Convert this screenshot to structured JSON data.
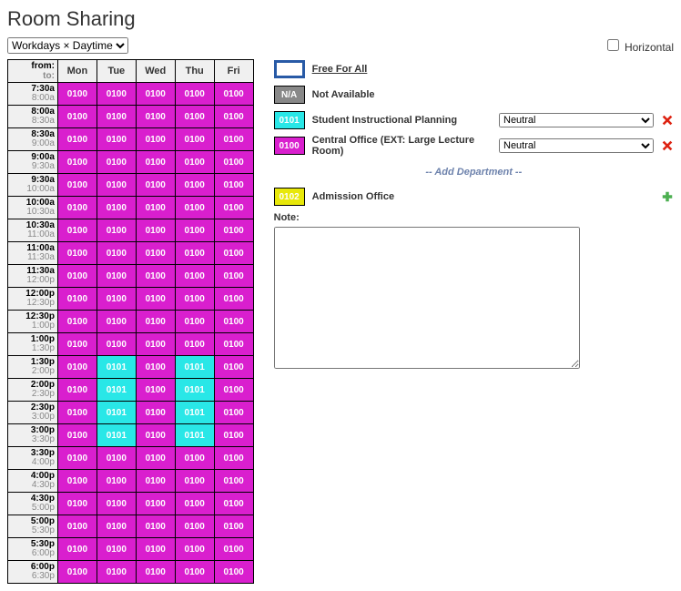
{
  "title": "Room Sharing",
  "mode_select": "Workdays × Daytime",
  "horizontal_label": "Horizontal",
  "horizontal_checked": false,
  "corner_from": "from:",
  "corner_to": "to:",
  "days": [
    "Mon",
    "Tue",
    "Wed",
    "Thu",
    "Fri"
  ],
  "times": [
    {
      "from": "7:30a",
      "to": "8:00a"
    },
    {
      "from": "8:00a",
      "to": "8:30a"
    },
    {
      "from": "8:30a",
      "to": "9:00a"
    },
    {
      "from": "9:00a",
      "to": "9:30a"
    },
    {
      "from": "9:30a",
      "to": "10:00a"
    },
    {
      "from": "10:00a",
      "to": "10:30a"
    },
    {
      "from": "10:30a",
      "to": "11:00a"
    },
    {
      "from": "11:00a",
      "to": "11:30a"
    },
    {
      "from": "11:30a",
      "to": "12:00p"
    },
    {
      "from": "12:00p",
      "to": "12:30p"
    },
    {
      "from": "12:30p",
      "to": "1:00p"
    },
    {
      "from": "1:00p",
      "to": "1:30p"
    },
    {
      "from": "1:30p",
      "to": "2:00p"
    },
    {
      "from": "2:00p",
      "to": "2:30p"
    },
    {
      "from": "2:30p",
      "to": "3:00p"
    },
    {
      "from": "3:00p",
      "to": "3:30p"
    },
    {
      "from": "3:30p",
      "to": "4:00p"
    },
    {
      "from": "4:00p",
      "to": "4:30p"
    },
    {
      "from": "4:30p",
      "to": "5:00p"
    },
    {
      "from": "5:00p",
      "to": "5:30p"
    },
    {
      "from": "5:30p",
      "to": "6:00p"
    },
    {
      "from": "6:00p",
      "to": "6:30p"
    }
  ],
  "grid": [
    [
      "0100",
      "0100",
      "0100",
      "0100",
      "0100"
    ],
    [
      "0100",
      "0100",
      "0100",
      "0100",
      "0100"
    ],
    [
      "0100",
      "0100",
      "0100",
      "0100",
      "0100"
    ],
    [
      "0100",
      "0100",
      "0100",
      "0100",
      "0100"
    ],
    [
      "0100",
      "0100",
      "0100",
      "0100",
      "0100"
    ],
    [
      "0100",
      "0100",
      "0100",
      "0100",
      "0100"
    ],
    [
      "0100",
      "0100",
      "0100",
      "0100",
      "0100"
    ],
    [
      "0100",
      "0100",
      "0100",
      "0100",
      "0100"
    ],
    [
      "0100",
      "0100",
      "0100",
      "0100",
      "0100"
    ],
    [
      "0100",
      "0100",
      "0100",
      "0100",
      "0100"
    ],
    [
      "0100",
      "0100",
      "0100",
      "0100",
      "0100"
    ],
    [
      "0100",
      "0100",
      "0100",
      "0100",
      "0100"
    ],
    [
      "0100",
      "0101",
      "0100",
      "0101",
      "0100"
    ],
    [
      "0100",
      "0101",
      "0100",
      "0101",
      "0100"
    ],
    [
      "0100",
      "0101",
      "0100",
      "0101",
      "0100"
    ],
    [
      "0100",
      "0101",
      "0100",
      "0101",
      "0100"
    ],
    [
      "0100",
      "0100",
      "0100",
      "0100",
      "0100"
    ],
    [
      "0100",
      "0100",
      "0100",
      "0100",
      "0100"
    ],
    [
      "0100",
      "0100",
      "0100",
      "0100",
      "0100"
    ],
    [
      "0100",
      "0100",
      "0100",
      "0100",
      "0100"
    ],
    [
      "0100",
      "0100",
      "0100",
      "0100",
      "0100"
    ],
    [
      "0100",
      "0100",
      "0100",
      "0100",
      "0100"
    ]
  ],
  "legend": {
    "free": {
      "label": "Free For All"
    },
    "na": {
      "code": "N/A",
      "label": "Not Available"
    },
    "depts": [
      {
        "code": "0101",
        "label": "Student Instructional Planning",
        "pref": "Neutral",
        "color": "c0101",
        "removable": true
      },
      {
        "code": "0100",
        "label": "Central Office (EXT: Large Lecture Room)",
        "pref": "Neutral",
        "color": "c0100",
        "removable": true
      }
    ],
    "add_label": "-- Add Department --",
    "new_dept": {
      "code": "0102",
      "label": "Admission Office",
      "color": "c0102"
    }
  },
  "note_label": "Note:",
  "note_value": "",
  "pref_options": [
    "Neutral"
  ]
}
